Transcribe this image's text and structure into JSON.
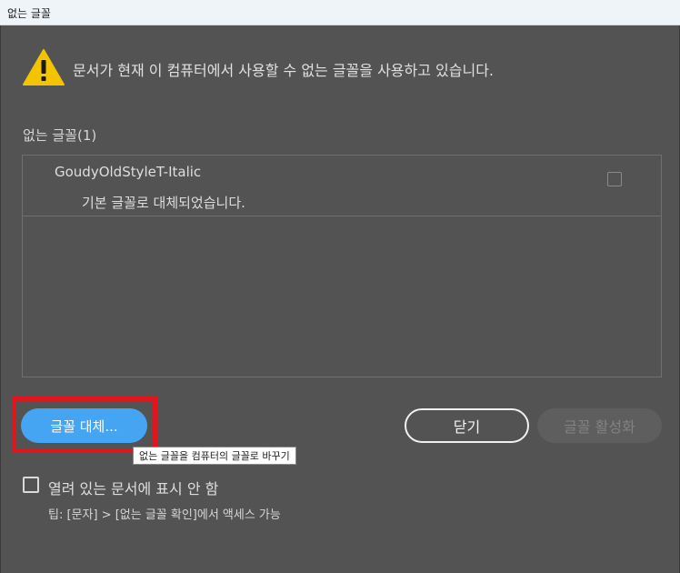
{
  "window": {
    "title": "없는 글꼴"
  },
  "message": "문서가 현재 이 컴퓨터에서 사용할 수 없는 글꼴을 사용하고 있습니다.",
  "missing_fonts_label": "없는 글꼴(1)",
  "missing_fonts": [
    {
      "name": "GoudyOldStyleT-Italic",
      "status": "기본 글꼴로 대체되었습니다.",
      "checked": false
    }
  ],
  "buttons": {
    "replace_label": "글꼴 대체...",
    "close_label": "닫기",
    "activate_label": "글꼴 활성화"
  },
  "tooltip": "없는 글꼴을 컴퓨터의 글꼴로 바꾸기",
  "dont_show_label": "열려 있는 문서에 표시 안 함",
  "tip": "팁: [문자] > [없는 글꼴 확인]에서 액세스 가능",
  "colors": {
    "background": "#535353",
    "primary_button": "#46a5f2",
    "highlight_box": "#e0161f",
    "warning": "#f5c400"
  },
  "icons": {
    "warning": "warning-triangle-icon"
  }
}
